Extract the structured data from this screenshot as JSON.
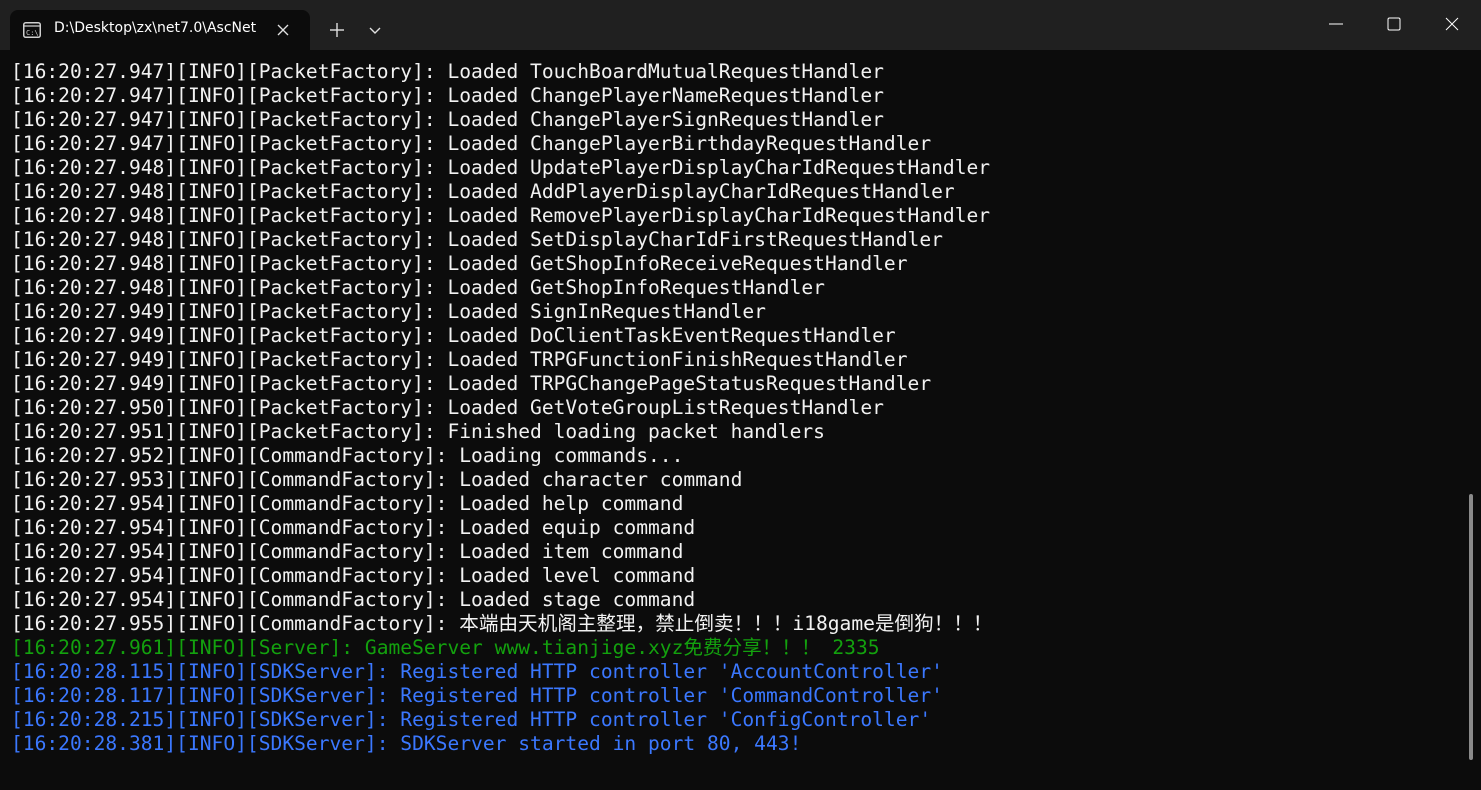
{
  "tab": {
    "title": "D:\\Desktop\\zx\\net7.0\\AscNet"
  },
  "icons": {
    "tab": "terminal-icon",
    "close_tab": "close-icon",
    "new_tab": "plus-icon",
    "dropdown": "chevron-down-icon",
    "minimize": "minimize-icon",
    "maximize": "maximize-icon",
    "close_window": "close-icon"
  },
  "colors": {
    "background": "#0c0c0c",
    "titlebar": "#202020",
    "default_text": "#f2f2f2",
    "server_text": "#13a10e",
    "sdk_text": "#3b78ff"
  },
  "console": {
    "lines": [
      {
        "text": "[16:20:27.947][INFO][PacketFactory]: Loaded TouchBoardMutualRequestHandler",
        "color": "#f2f2f2"
      },
      {
        "text": "[16:20:27.947][INFO][PacketFactory]: Loaded ChangePlayerNameRequestHandler",
        "color": "#f2f2f2"
      },
      {
        "text": "[16:20:27.947][INFO][PacketFactory]: Loaded ChangePlayerSignRequestHandler",
        "color": "#f2f2f2"
      },
      {
        "text": "[16:20:27.947][INFO][PacketFactory]: Loaded ChangePlayerBirthdayRequestHandler",
        "color": "#f2f2f2"
      },
      {
        "text": "[16:20:27.948][INFO][PacketFactory]: Loaded UpdatePlayerDisplayCharIdRequestHandler",
        "color": "#f2f2f2"
      },
      {
        "text": "[16:20:27.948][INFO][PacketFactory]: Loaded AddPlayerDisplayCharIdRequestHandler",
        "color": "#f2f2f2"
      },
      {
        "text": "[16:20:27.948][INFO][PacketFactory]: Loaded RemovePlayerDisplayCharIdRequestHandler",
        "color": "#f2f2f2"
      },
      {
        "text": "[16:20:27.948][INFO][PacketFactory]: Loaded SetDisplayCharIdFirstRequestHandler",
        "color": "#f2f2f2"
      },
      {
        "text": "[16:20:27.948][INFO][PacketFactory]: Loaded GetShopInfoReceiveRequestHandler",
        "color": "#f2f2f2"
      },
      {
        "text": "[16:20:27.948][INFO][PacketFactory]: Loaded GetShopInfoRequestHandler",
        "color": "#f2f2f2"
      },
      {
        "text": "[16:20:27.949][INFO][PacketFactory]: Loaded SignInRequestHandler",
        "color": "#f2f2f2"
      },
      {
        "text": "[16:20:27.949][INFO][PacketFactory]: Loaded DoClientTaskEventRequestHandler",
        "color": "#f2f2f2"
      },
      {
        "text": "[16:20:27.949][INFO][PacketFactory]: Loaded TRPGFunctionFinishRequestHandler",
        "color": "#f2f2f2"
      },
      {
        "text": "[16:20:27.949][INFO][PacketFactory]: Loaded TRPGChangePageStatusRequestHandler",
        "color": "#f2f2f2"
      },
      {
        "text": "[16:20:27.950][INFO][PacketFactory]: Loaded GetVoteGroupListRequestHandler",
        "color": "#f2f2f2"
      },
      {
        "text": "[16:20:27.951][INFO][PacketFactory]: Finished loading packet handlers",
        "color": "#f2f2f2"
      },
      {
        "text": "[16:20:27.952][INFO][CommandFactory]: Loading commands...",
        "color": "#f2f2f2"
      },
      {
        "text": "[16:20:27.953][INFO][CommandFactory]: Loaded character command",
        "color": "#f2f2f2"
      },
      {
        "text": "[16:20:27.954][INFO][CommandFactory]: Loaded help command",
        "color": "#f2f2f2"
      },
      {
        "text": "[16:20:27.954][INFO][CommandFactory]: Loaded equip command",
        "color": "#f2f2f2"
      },
      {
        "text": "[16:20:27.954][INFO][CommandFactory]: Loaded item command",
        "color": "#f2f2f2"
      },
      {
        "text": "[16:20:27.954][INFO][CommandFactory]: Loaded level command",
        "color": "#f2f2f2"
      },
      {
        "text": "[16:20:27.954][INFO][CommandFactory]: Loaded stage command",
        "color": "#f2f2f2"
      },
      {
        "text": "[16:20:27.955][INFO][CommandFactory]: 本端由天机阁主整理，禁止倒卖！！！i18game是倒狗！！！",
        "color": "#f2f2f2"
      },
      {
        "text": "[16:20:27.961][INFO][Server]: GameServer www.tianjige.xyz免费分享！！！ 2335",
        "color": "#13a10e"
      },
      {
        "text": "[16:20:28.115][INFO][SDKServer]: Registered HTTP controller 'AccountController'",
        "color": "#3b78ff"
      },
      {
        "text": "[16:20:28.117][INFO][SDKServer]: Registered HTTP controller 'CommandController'",
        "color": "#3b78ff"
      },
      {
        "text": "[16:20:28.215][INFO][SDKServer]: Registered HTTP controller 'ConfigController'",
        "color": "#3b78ff"
      },
      {
        "text": "[16:20:28.381][INFO][SDKServer]: SDKServer started in port 80, 443!",
        "color": "#3b78ff"
      }
    ]
  }
}
